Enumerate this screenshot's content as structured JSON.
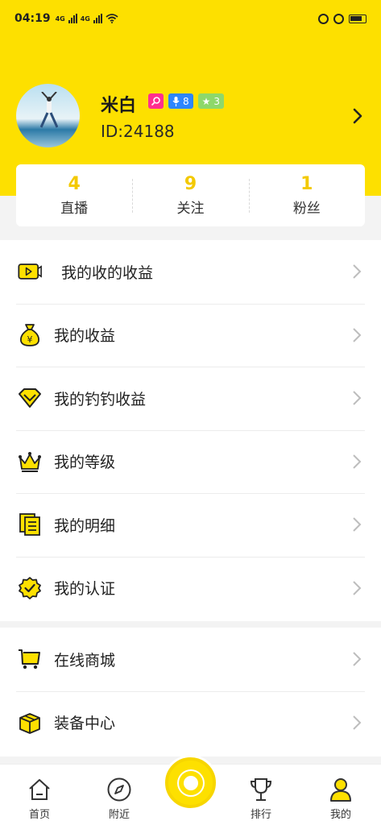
{
  "status_bar": {
    "time": "04:19",
    "network_1": "4G",
    "network_2": "4G"
  },
  "profile": {
    "name": "米白",
    "id_text": "ID:24188",
    "badge_mic_level": "8",
    "badge_star_level": "3"
  },
  "stats": [
    {
      "value": "4",
      "label": "直播"
    },
    {
      "value": "9",
      "label": "关注"
    },
    {
      "value": "1",
      "label": "粉丝"
    }
  ],
  "menu_main": [
    {
      "label": "我的收的收益",
      "icon": "video-play-icon"
    },
    {
      "label": "我的收益",
      "icon": "money-bag-icon"
    },
    {
      "label": "我的钓钓收益",
      "icon": "diamond-icon"
    },
    {
      "label": "我的等级",
      "icon": "crown-icon"
    },
    {
      "label": "我的明细",
      "icon": "list-detail-icon"
    },
    {
      "label": "我的认证",
      "icon": "verified-badge-icon"
    }
  ],
  "menu_secondary": [
    {
      "label": "在线商城",
      "icon": "shopping-cart-icon"
    },
    {
      "label": "装备中心",
      "icon": "package-box-icon"
    }
  ],
  "nav": [
    {
      "label": "首页",
      "icon": "home-icon"
    },
    {
      "label": "附近",
      "icon": "compass-icon"
    },
    {
      "label": "排行",
      "icon": "trophy-icon"
    },
    {
      "label": "我的",
      "icon": "profile-icon"
    }
  ],
  "colors": {
    "accent": "#fde000",
    "stat_number": "#f3c900"
  }
}
